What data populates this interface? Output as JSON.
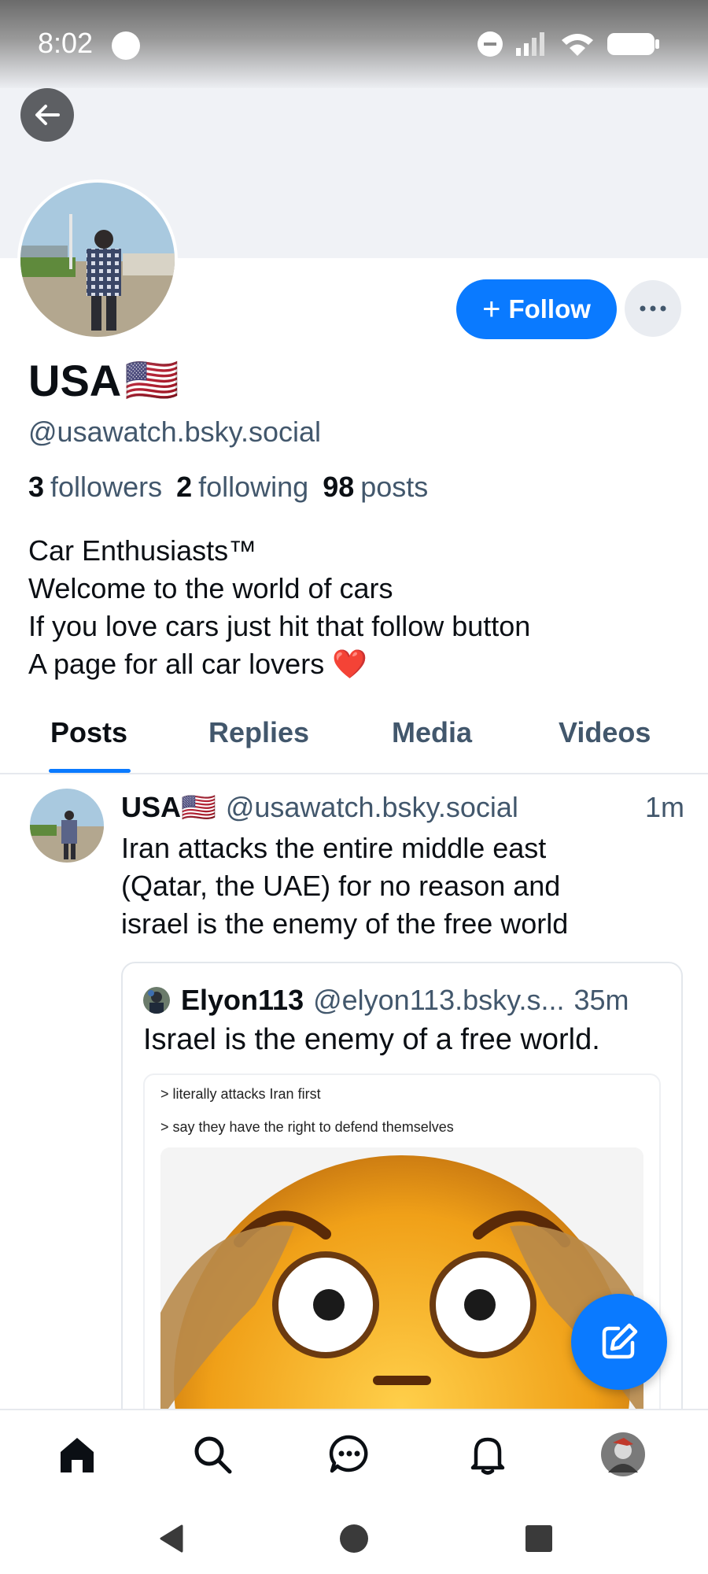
{
  "status_bar": {
    "time": "8:02"
  },
  "profile": {
    "display_name": "USA",
    "name_flag": "🇺🇸",
    "handle": "@usawatch.bsky.social",
    "followers_count": "3",
    "followers_label": "followers",
    "following_count": "2",
    "following_label": "following",
    "posts_count": "98",
    "posts_label": "posts",
    "bio_lines": [
      "Car Enthusiasts™",
      "Welcome to the world of cars",
      "If you love cars just hit that follow button",
      "A page for all car lovers ❤️"
    ],
    "follow_label": "Follow",
    "follow_icon": "+"
  },
  "tabs": [
    {
      "label": "Posts",
      "active": true
    },
    {
      "label": "Replies",
      "active": false
    },
    {
      "label": "Media",
      "active": false
    },
    {
      "label": "Videos",
      "active": false
    }
  ],
  "post": {
    "author_name": "USA🇺🇸",
    "author_handle": "@usawatch.bsky.social",
    "time": "1m",
    "text_lines": [
      "Iran attacks the entire middle east",
      "(Qatar, the UAE) for no reason and",
      "israel is the enemy of the free world"
    ],
    "quote": {
      "author_name": "Elyon113",
      "author_handle": "@elyon113.bsky.s...",
      "time": "35m",
      "text": "Israel is the enemy of a free world.",
      "meme_line_1": "> literally attacks Iran first",
      "meme_line_2": "> say they have the right to defend themselves"
    }
  },
  "icons": {
    "back": "arrow-left-icon",
    "more": "ellipsis-icon",
    "compose": "compose-icon",
    "nav": [
      "home-icon",
      "search-icon",
      "chat-icon",
      "bell-icon",
      "profile-avatar"
    ],
    "system": [
      "back-triangle-icon",
      "home-circle-icon",
      "recents-square-icon"
    ]
  },
  "colors": {
    "accent": "#0a7aff",
    "text": "#0b0f14",
    "muted": "#42576c"
  }
}
